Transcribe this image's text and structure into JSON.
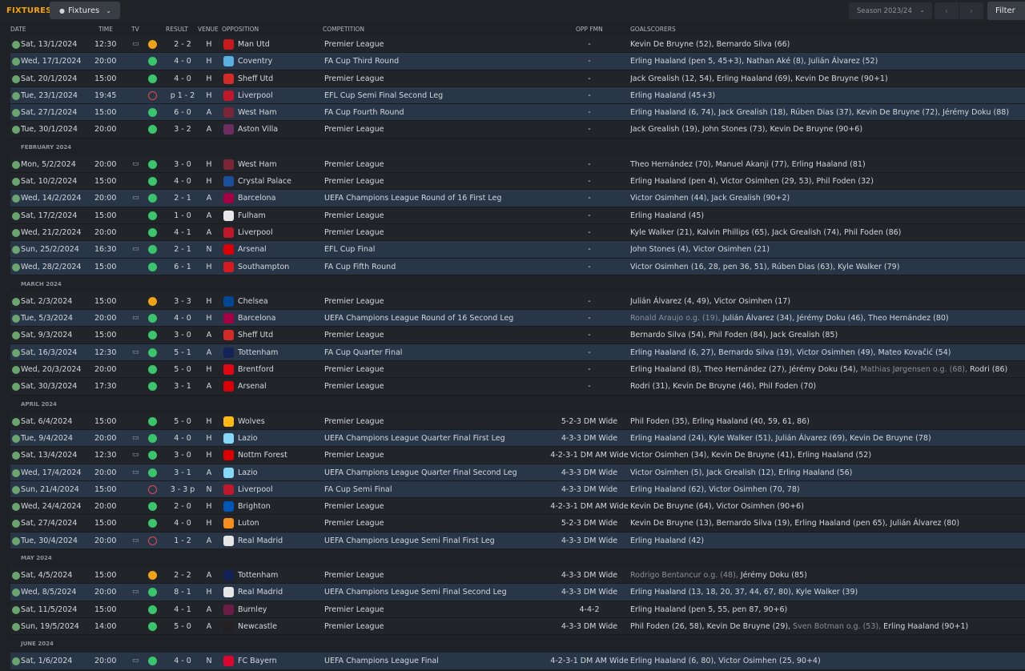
{
  "top": {
    "title": "FIXTURES",
    "view_label": "Fixtures",
    "season_label": "Season 2023/24",
    "filter_label": "Filter",
    "prev_arrow": "‹",
    "next_arrow": "›"
  },
  "columns": {
    "date": "DATE",
    "time": "TIME",
    "tv": "TV",
    "result": "RESULT",
    "venue": "VENUE",
    "opposition": "OPPOSITION",
    "competition": "COMPETITION",
    "opp_fmn": "OPP FMN",
    "goalscorers": "GOALSCORERS"
  },
  "colors": {
    "accent": "#f5a200",
    "win": "#3ac46b",
    "draw": "#f0a318",
    "loss": "#e04a4a",
    "row_highlight": "#283647"
  },
  "rows": [
    {
      "type": "match",
      "date": "Sat, 13/1/2024",
      "time": "12:30",
      "tv": true,
      "res": "draw",
      "result": "2 - 2",
      "venue": "H",
      "opp": "Man Utd",
      "crest": "#c81a1a",
      "comp": "Premier League",
      "fmn": "-",
      "scorers": [
        [
          "Kevin De Bruyne (52), Bernardo Silva (66)",
          false
        ]
      ],
      "alt": false
    },
    {
      "type": "match",
      "date": "Wed, 17/1/2024",
      "time": "20:00",
      "tv": false,
      "res": "win",
      "result": "4 - 0",
      "venue": "H",
      "opp": "Coventry",
      "crest": "#5ab0e0",
      "comp": "FA Cup Third Round",
      "fmn": "-",
      "scorers": [
        [
          "Erling Haaland (pen 5, 45+3), Nathan Aké (8), Julián Álvarez (52)",
          false
        ]
      ],
      "alt": true
    },
    {
      "type": "match",
      "date": "Sat, 20/1/2024",
      "time": "15:00",
      "tv": false,
      "res": "win",
      "result": "4 - 0",
      "venue": "H",
      "opp": "Sheff Utd",
      "crest": "#d32a2a",
      "comp": "Premier League",
      "fmn": "-",
      "scorers": [
        [
          "Jack Grealish (12, 54), Erling Haaland (69), Kevin De Bruyne (90+1)",
          false
        ]
      ],
      "alt": false
    },
    {
      "type": "match",
      "date": "Tue, 23/1/2024",
      "time": "19:45",
      "tv": false,
      "res": "loss",
      "result": "p 1 - 2",
      "venue": "H",
      "opp": "Liverpool",
      "crest": "#c0182b",
      "comp": "EFL Cup Semi Final Second Leg",
      "fmn": "-",
      "scorers": [
        [
          "Erling Haaland (45+3)",
          false
        ]
      ],
      "alt": true
    },
    {
      "type": "match",
      "date": "Sat, 27/1/2024",
      "time": "15:00",
      "tv": false,
      "res": "win",
      "result": "6 - 0",
      "venue": "A",
      "opp": "West Ham",
      "crest": "#7a2636",
      "comp": "FA Cup Fourth Round",
      "fmn": "-",
      "scorers": [
        [
          "Erling Haaland (6, 74), Jack Grealish (18), Rúben Dias (37), Kevin De Bruyne (72), Jérémy Doku (88)",
          false
        ]
      ],
      "alt": true
    },
    {
      "type": "match",
      "date": "Tue, 30/1/2024",
      "time": "20:00",
      "tv": false,
      "res": "win",
      "result": "3 - 2",
      "venue": "A",
      "opp": "Aston Villa",
      "crest": "#6d2d5e",
      "comp": "Premier League",
      "fmn": "-",
      "scorers": [
        [
          "Jack Grealish (19), John Stones (73), Kevin De Bruyne (90+6)",
          false
        ]
      ],
      "alt": false
    },
    {
      "type": "section",
      "label": "FEBRUARY 2024"
    },
    {
      "type": "match",
      "date": "Mon, 5/2/2024",
      "time": "20:00",
      "tv": true,
      "res": "win",
      "result": "3 - 0",
      "venue": "H",
      "opp": "West Ham",
      "crest": "#7a2636",
      "comp": "Premier League",
      "fmn": "-",
      "scorers": [
        [
          "Theo Hernández (70), Manuel Akanji (77), Erling Haaland (81)",
          false
        ]
      ],
      "alt": false
    },
    {
      "type": "match",
      "date": "Sat, 10/2/2024",
      "time": "15:00",
      "tv": false,
      "res": "win",
      "result": "4 - 0",
      "venue": "H",
      "opp": "Crystal Palace",
      "crest": "#1b4f9c",
      "comp": "Premier League",
      "fmn": "-",
      "scorers": [
        [
          "Erling Haaland (pen 4), Victor Osimhen (29, 53), Phil Foden (32)",
          false
        ]
      ],
      "alt": false
    },
    {
      "type": "match",
      "date": "Wed, 14/2/2024",
      "time": "20:00",
      "tv": true,
      "res": "win",
      "result": "2 - 1",
      "venue": "A",
      "opp": "Barcelona",
      "crest": "#a50044",
      "comp": "UEFA Champions League Round of 16 First Leg",
      "fmn": "-",
      "scorers": [
        [
          "Victor Osimhen (44), Jack Grealish (90+2)",
          false
        ]
      ],
      "alt": true
    },
    {
      "type": "match",
      "date": "Sat, 17/2/2024",
      "time": "15:00",
      "tv": false,
      "res": "win",
      "result": "1 - 0",
      "venue": "A",
      "opp": "Fulham",
      "crest": "#e8e8e8",
      "comp": "Premier League",
      "fmn": "-",
      "scorers": [
        [
          "Erling Haaland (45)",
          false
        ]
      ],
      "alt": false
    },
    {
      "type": "match",
      "date": "Wed, 21/2/2024",
      "time": "20:00",
      "tv": false,
      "res": "win",
      "result": "4 - 1",
      "venue": "A",
      "opp": "Liverpool",
      "crest": "#c0182b",
      "comp": "Premier League",
      "fmn": "-",
      "scorers": [
        [
          "Kyle Walker (21), Kalvin Phillips (65), Jack Grealish (74), Phil Foden (86)",
          false
        ]
      ],
      "alt": false
    },
    {
      "type": "match",
      "date": "Sun, 25/2/2024",
      "time": "16:30",
      "tv": true,
      "res": "win",
      "result": "2 - 1",
      "venue": "N",
      "opp": "Arsenal",
      "crest": "#db0007",
      "comp": "EFL Cup Final",
      "fmn": "-",
      "scorers": [
        [
          "John Stones (4), Victor Osimhen (21)",
          false
        ]
      ],
      "alt": true
    },
    {
      "type": "match",
      "date": "Wed, 28/2/2024",
      "time": "15:00",
      "tv": false,
      "res": "win",
      "result": "6 - 1",
      "venue": "H",
      "opp": "Southampton",
      "crest": "#d71920",
      "comp": "FA Cup Fifth Round",
      "fmn": "-",
      "scorers": [
        [
          "Victor Osimhen (16, 28, pen 36, 51), Rúben Dias (63), Kyle Walker (79)",
          false
        ]
      ],
      "alt": true
    },
    {
      "type": "section",
      "label": "MARCH 2024"
    },
    {
      "type": "match",
      "date": "Sat, 2/3/2024",
      "time": "15:00",
      "tv": false,
      "res": "draw",
      "result": "3 - 3",
      "venue": "H",
      "opp": "Chelsea",
      "crest": "#034694",
      "comp": "Premier League",
      "fmn": "-",
      "scorers": [
        [
          "Julián Álvarez (4, 49), Victor Osimhen (17)",
          false
        ]
      ],
      "alt": false
    },
    {
      "type": "match",
      "date": "Tue, 5/3/2024",
      "time": "20:00",
      "tv": true,
      "res": "win",
      "result": "4 - 0",
      "venue": "H",
      "opp": "Barcelona",
      "crest": "#a50044",
      "comp": "UEFA Champions League Round of 16 Second Leg",
      "fmn": "-",
      "scorers": [
        [
          "Ronald Araujo o.g. (19), ",
          true
        ],
        [
          "Julián Álvarez (34), Jérémy Doku (46), Theo Hernández (80)",
          false
        ]
      ],
      "alt": true
    },
    {
      "type": "match",
      "date": "Sat, 9/3/2024",
      "time": "15:00",
      "tv": false,
      "res": "win",
      "result": "3 - 0",
      "venue": "A",
      "opp": "Sheff Utd",
      "crest": "#d32a2a",
      "comp": "Premier League",
      "fmn": "-",
      "scorers": [
        [
          "Bernardo Silva (54), Phil Foden (84), Jack Grealish (85)",
          false
        ]
      ],
      "alt": false
    },
    {
      "type": "match",
      "date": "Sat, 16/3/2024",
      "time": "12:30",
      "tv": true,
      "res": "win",
      "result": "5 - 1",
      "venue": "A",
      "opp": "Tottenham",
      "crest": "#132257",
      "comp": "FA Cup Quarter Final",
      "fmn": "-",
      "scorers": [
        [
          "Erling Haaland (6, 27), Bernardo Silva (19), Victor Osimhen (49), Mateo Kovačić (54)",
          false
        ]
      ],
      "alt": true
    },
    {
      "type": "match",
      "date": "Wed, 20/3/2024",
      "time": "20:00",
      "tv": false,
      "res": "win",
      "result": "5 - 0",
      "venue": "H",
      "opp": "Brentford",
      "crest": "#e30613",
      "comp": "Premier League",
      "fmn": "-",
      "scorers": [
        [
          "Erling Haaland (8), Theo Hernández (27), Jérémy Doku (54), ",
          false
        ],
        [
          "Mathias Jørgensen o.g. (68), ",
          true
        ],
        [
          "Rodri (86)",
          false
        ]
      ],
      "alt": false
    },
    {
      "type": "match",
      "date": "Sat, 30/3/2024",
      "time": "17:30",
      "tv": false,
      "res": "win",
      "result": "3 - 1",
      "venue": "A",
      "opp": "Arsenal",
      "crest": "#db0007",
      "comp": "Premier League",
      "fmn": "-",
      "scorers": [
        [
          "Rodri (31), Kevin De Bruyne (46), Phil Foden (70)",
          false
        ]
      ],
      "alt": false
    },
    {
      "type": "section",
      "label": "APRIL 2024"
    },
    {
      "type": "match",
      "date": "Sat, 6/4/2024",
      "time": "15:00",
      "tv": false,
      "res": "win",
      "result": "5 - 0",
      "venue": "H",
      "opp": "Wolves",
      "crest": "#fdb913",
      "comp": "Premier League",
      "fmn": "5-2-3 DM Wide",
      "scorers": [
        [
          "Phil Foden (35), Erling Haaland (40, 59, 61, 86)",
          false
        ]
      ],
      "alt": false
    },
    {
      "type": "match",
      "date": "Tue, 9/4/2024",
      "time": "20:00",
      "tv": true,
      "res": "win",
      "result": "4 - 0",
      "venue": "H",
      "opp": "Lazio",
      "crest": "#87d8f7",
      "comp": "UEFA Champions League Quarter Final First Leg",
      "fmn": "4-3-3 DM Wide",
      "scorers": [
        [
          "Erling Haaland (24), Kyle Walker (51), Julián Álvarez (69), Kevin De Bruyne (78)",
          false
        ]
      ],
      "alt": true
    },
    {
      "type": "match",
      "date": "Sat, 13/4/2024",
      "time": "12:30",
      "tv": true,
      "res": "win",
      "result": "3 - 0",
      "venue": "H",
      "opp": "Nottm Forest",
      "crest": "#dd0000",
      "comp": "Premier League",
      "fmn": "4-2-3-1 DM AM Wide",
      "scorers": [
        [
          "Victor Osimhen (34), Kevin De Bruyne (41), Erling Haaland (52)",
          false
        ]
      ],
      "alt": false
    },
    {
      "type": "match",
      "date": "Wed, 17/4/2024",
      "time": "20:00",
      "tv": true,
      "res": "win",
      "result": "3 - 1",
      "venue": "A",
      "opp": "Lazio",
      "crest": "#87d8f7",
      "comp": "UEFA Champions League Quarter Final Second Leg",
      "fmn": "4-3-3 DM Wide",
      "scorers": [
        [
          "Victor Osimhen (5), Jack Grealish (12), Erling Haaland (56)",
          false
        ]
      ],
      "alt": true
    },
    {
      "type": "match",
      "date": "Sun, 21/4/2024",
      "time": "15:00",
      "tv": false,
      "res": "loss",
      "result": "3 - 3 p",
      "venue": "N",
      "opp": "Liverpool",
      "crest": "#c0182b",
      "comp": "FA Cup Semi Final",
      "fmn": "4-3-3 DM Wide",
      "scorers": [
        [
          "Erling Haaland (62), Victor Osimhen (70, 78)",
          false
        ]
      ],
      "alt": true
    },
    {
      "type": "match",
      "date": "Wed, 24/4/2024",
      "time": "20:00",
      "tv": false,
      "res": "win",
      "result": "2 - 0",
      "venue": "H",
      "opp": "Brighton",
      "crest": "#0057b8",
      "comp": "Premier League",
      "fmn": "4-2-3-1 DM AM Wide",
      "scorers": [
        [
          "Kevin De Bruyne (64), Victor Osimhen (90+6)",
          false
        ]
      ],
      "alt": false
    },
    {
      "type": "match",
      "date": "Sat, 27/4/2024",
      "time": "15:00",
      "tv": false,
      "res": "win",
      "result": "4 - 0",
      "venue": "H",
      "opp": "Luton",
      "crest": "#f78f1e",
      "comp": "Premier League",
      "fmn": "5-2-3 DM Wide",
      "scorers": [
        [
          "Kevin De Bruyne (13), Bernardo Silva (19), Erling Haaland (pen 65), Julián Álvarez (80)",
          false
        ]
      ],
      "alt": false
    },
    {
      "type": "match",
      "date": "Tue, 30/4/2024",
      "time": "20:00",
      "tv": true,
      "res": "loss",
      "result": "1 - 2",
      "venue": "A",
      "opp": "Real Madrid",
      "crest": "#e6e6e6",
      "comp": "UEFA Champions League Semi Final First Leg",
      "fmn": "4-3-3 DM Wide",
      "scorers": [
        [
          "Erling Haaland (42)",
          false
        ]
      ],
      "alt": true
    },
    {
      "type": "section",
      "label": "MAY 2024"
    },
    {
      "type": "match",
      "date": "Sat, 4/5/2024",
      "time": "15:00",
      "tv": false,
      "res": "draw",
      "result": "2 - 2",
      "venue": "A",
      "opp": "Tottenham",
      "crest": "#132257",
      "comp": "Premier League",
      "fmn": "4-3-3 DM Wide",
      "scorers": [
        [
          "Rodrigo Bentancur o.g. (48), ",
          true
        ],
        [
          "Jérémy Doku (85)",
          false
        ]
      ],
      "alt": false
    },
    {
      "type": "match",
      "date": "Wed, 8/5/2024",
      "time": "20:00",
      "tv": true,
      "res": "win",
      "result": "8 - 1",
      "venue": "H",
      "opp": "Real Madrid",
      "crest": "#e6e6e6",
      "comp": "UEFA Champions League Semi Final Second Leg",
      "fmn": "4-3-3 DM Wide",
      "scorers": [
        [
          "Erling Haaland (13, 18, 20, 37, 44, 67, 80), Kyle Walker (39)",
          false
        ]
      ],
      "alt": true
    },
    {
      "type": "match",
      "date": "Sat, 11/5/2024",
      "time": "15:00",
      "tv": false,
      "res": "win",
      "result": "4 - 1",
      "venue": "A",
      "opp": "Burnley",
      "crest": "#6c1d45",
      "comp": "Premier League",
      "fmn": "4-4-2",
      "scorers": [
        [
          "Erling Haaland (pen 5, 55, pen 87, 90+6)",
          false
        ]
      ],
      "alt": false
    },
    {
      "type": "match",
      "date": "Sun, 19/5/2024",
      "time": "14:00",
      "tv": false,
      "res": "win",
      "result": "5 - 0",
      "venue": "A",
      "opp": "Newcastle",
      "crest": "#241f20",
      "comp": "Premier League",
      "fmn": "4-3-3 DM Wide",
      "scorers": [
        [
          "Phil Foden (26, 58), Kevin De Bruyne (29), ",
          false
        ],
        [
          "Sven Botman o.g. (53), ",
          true
        ],
        [
          "Erling Haaland (90+1)",
          false
        ]
      ],
      "alt": false
    },
    {
      "type": "section",
      "label": "JUNE 2024"
    },
    {
      "type": "match",
      "date": "Sat, 1/6/2024",
      "time": "20:00",
      "tv": true,
      "res": "win",
      "result": "4 - 0",
      "venue": "N",
      "opp": "FC Bayern",
      "crest": "#dc052d",
      "comp": "UEFA Champions League Final",
      "fmn": "4-2-3-1 DM AM Wide",
      "scorers": [
        [
          "Erling Haaland (6, 80), Victor Osimhen (25, 90+4)",
          false
        ]
      ],
      "alt": true
    }
  ]
}
